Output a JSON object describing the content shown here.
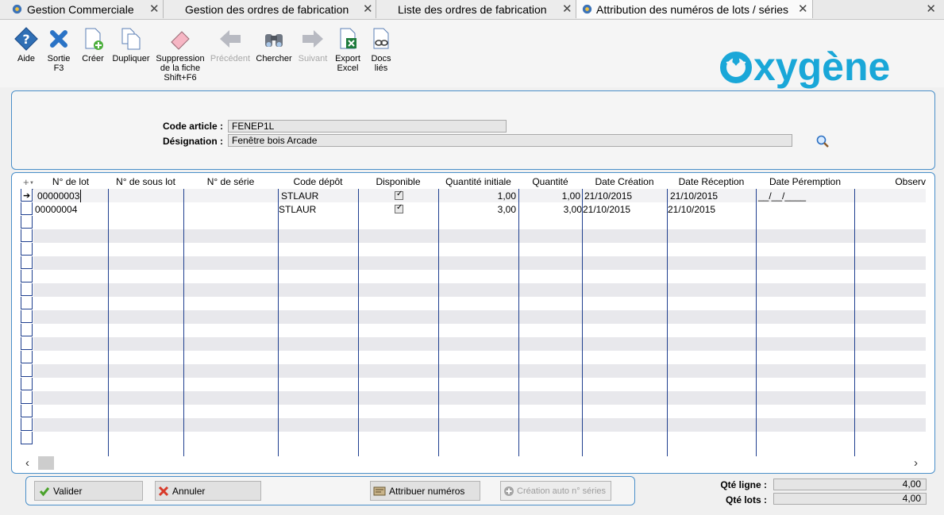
{
  "tabs": [
    {
      "label": "Gestion Commerciale",
      "icon": "gear-icon",
      "active": false
    },
    {
      "label": "Gestion des ordres de fabrication",
      "active": false
    },
    {
      "label": "Liste des ordres de fabrication",
      "active": false
    },
    {
      "label": "Attribution des numéros de lots / séries",
      "icon": "gear-icon",
      "active": true
    }
  ],
  "toolbar": {
    "help": "Aide",
    "exit": "Sortie",
    "exit_key": "F3",
    "create": "Créer",
    "duplicate": "Dupliquer",
    "delete_l1": "Suppression",
    "delete_l2": "de la fiche",
    "delete_key": "Shift+F6",
    "previous": "Précédent",
    "search": "Chercher",
    "next": "Suivant",
    "export_l1": "Export",
    "export_l2": "Excel",
    "docs_l1": "Docs",
    "docs_l2": "liés"
  },
  "brand": {
    "logo_text": "oxygène",
    "color": "#1aa7d8"
  },
  "article": {
    "code_label": "Code article :",
    "code_value": "FENEP1L",
    "designation_label": "Désignation :",
    "designation_value": "Fenêtre bois Arcade"
  },
  "grid": {
    "columns": [
      "N° de lot",
      "N° de sous lot",
      "N° de série",
      "Code dépôt",
      "Disponible",
      "Quantité initiale",
      "Quantité",
      "Date Création",
      "Date Réception",
      "Date Péremption",
      "Observ"
    ],
    "rows": [
      {
        "lot": "00000003",
        "sous_lot": "",
        "serie": "",
        "depot": "STLAUR",
        "disponible": true,
        "qte_initiale": "1,00",
        "qte": "1,00",
        "date_creation": "21/10/2015",
        "date_reception": "21/10/2015",
        "date_peremption": "__/__/____",
        "current": true
      },
      {
        "lot": "00000004",
        "sous_lot": "",
        "serie": "",
        "depot": "STLAUR",
        "disponible": true,
        "qte_initiale": "3,00",
        "qte": "3,00",
        "date_creation": "21/10/2015",
        "date_reception": "21/10/2015",
        "date_peremption": "",
        "current": false
      }
    ]
  },
  "actions": {
    "validate": "Valider",
    "cancel": "Annuler",
    "assign": "Attribuer numéros",
    "auto_serial": "Création auto n° séries"
  },
  "totals": {
    "qte_ligne_label": "Qté ligne :",
    "qte_ligne_value": "4,00",
    "qte_lots_label": "Qté lots :",
    "qte_lots_value": "4,00"
  },
  "colors": {
    "accent": "#4a8fc9",
    "grid_line": "#1f3f8f",
    "row_alt": "#e8e8ec"
  }
}
